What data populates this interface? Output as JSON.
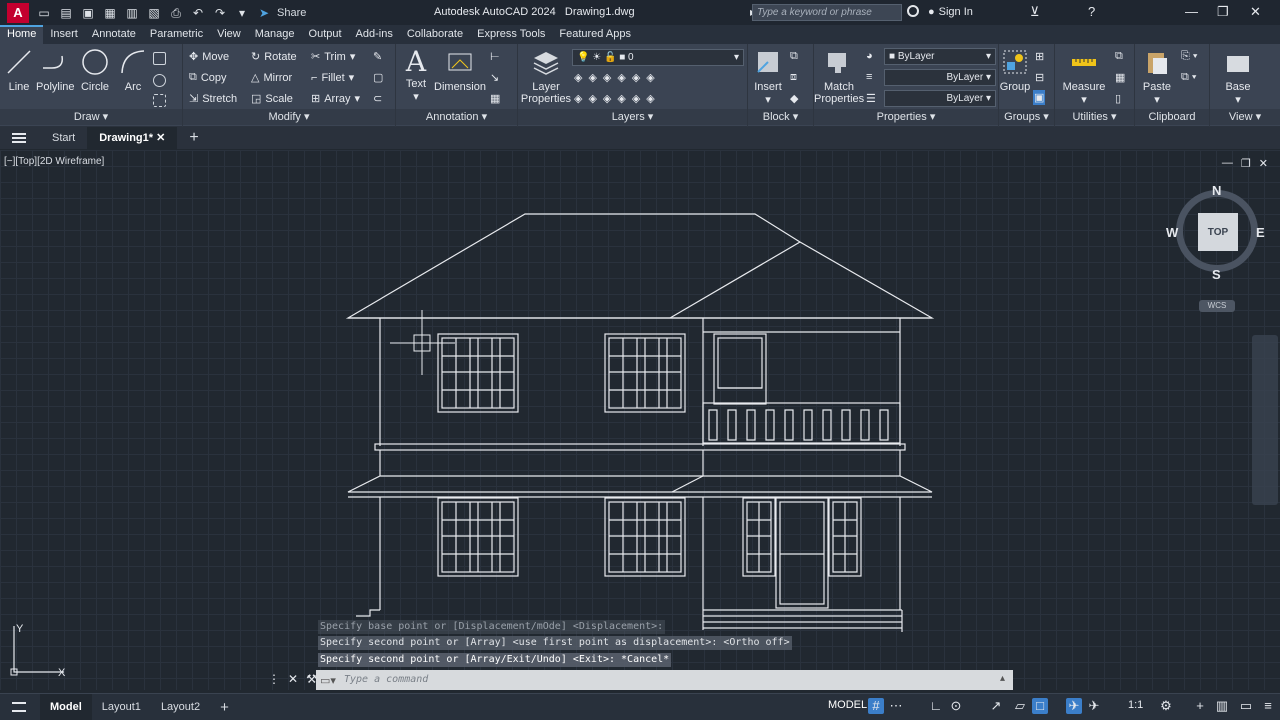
{
  "app": {
    "title": "Autodesk AutoCAD 2024",
    "file": "Drawing1.dwg",
    "logo": "A",
    "share": "Share",
    "search_placeholder": "Type a keyword or phrase",
    "signin": "Sign In"
  },
  "ribbon_tabs": [
    "Home",
    "Insert",
    "Annotate",
    "Parametric",
    "View",
    "Manage",
    "Output",
    "Add-ins",
    "Collaborate",
    "Express Tools",
    "Featured Apps"
  ],
  "panels": {
    "draw": {
      "title": "Draw",
      "tools": [
        "Line",
        "Polyline",
        "Circle",
        "Arc"
      ]
    },
    "modify": {
      "title": "Modify",
      "tools": [
        "Move",
        "Rotate",
        "Trim",
        "Copy",
        "Mirror",
        "Fillet",
        "Stretch",
        "Scale",
        "Array"
      ]
    },
    "annotation": {
      "title": "Annotation",
      "tools": [
        "Text",
        "Dimension"
      ]
    },
    "layers": {
      "title": "Layers",
      "tool": "Layer Properties",
      "current_layer": "0"
    },
    "block": {
      "title": "Block",
      "tool": "Insert"
    },
    "properties": {
      "title": "Properties",
      "tool": "Match Properties",
      "color": "ByLayer",
      "linetype": "ByLayer",
      "lineweight": "ByLayer"
    },
    "groups": {
      "title": "Groups",
      "tool": "Group"
    },
    "utilities": {
      "title": "Utilities",
      "tool": "Measure"
    },
    "clipboard": {
      "title": "Clipboard",
      "tool": "Paste"
    },
    "view": {
      "title": "View",
      "tool": "Base"
    }
  },
  "doc_tabs": {
    "start": "Start",
    "active": "Drawing1*"
  },
  "viewport": {
    "label": "[−][Top][2D Wireframe]",
    "cube_face": "TOP",
    "compass": {
      "n": "N",
      "s": "S",
      "e": "E",
      "w": "W"
    },
    "wcs": "WCS"
  },
  "command": {
    "history": [
      "Specify base point or [Displacement/mOde] <Displacement>:",
      "Specify second point or [Array] <use first point as displacement>:  <Ortho off>",
      "Specify second point or [Array/Exit/Undo] <Exit>: *Cancel*"
    ],
    "placeholder": "Type a command"
  },
  "ucs": {
    "x": "X",
    "y": "Y"
  },
  "status": {
    "layouts": [
      "Model",
      "Layout1",
      "Layout2"
    ],
    "mode": "MODEL",
    "scale": "1:1"
  },
  "colors": {
    "canvas": "#212830",
    "ribbon": "#3b4453",
    "accent": "#3b7ec9",
    "drawing_lines": "#e8eaee"
  }
}
